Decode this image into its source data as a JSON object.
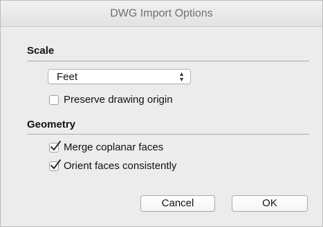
{
  "window": {
    "title": "DWG Import Options"
  },
  "scale_section": {
    "title": "Scale",
    "units_popup": {
      "selected": "Feet",
      "arrows_icon": "up-down-chevron-icon"
    },
    "preserve_origin": {
      "label": "Preserve drawing origin",
      "checked": false
    }
  },
  "geometry_section": {
    "title": "Geometry",
    "merge_coplanar": {
      "label": "Merge coplanar faces",
      "checked": true
    },
    "orient_faces": {
      "label": "Orient faces consistently",
      "checked": true
    }
  },
  "buttons": {
    "cancel_label": "Cancel",
    "ok_label": "OK"
  },
  "colors": {
    "dialog_background": "#ececec",
    "title_text": "#6f6f6f",
    "separator": "#a9a9a9"
  }
}
